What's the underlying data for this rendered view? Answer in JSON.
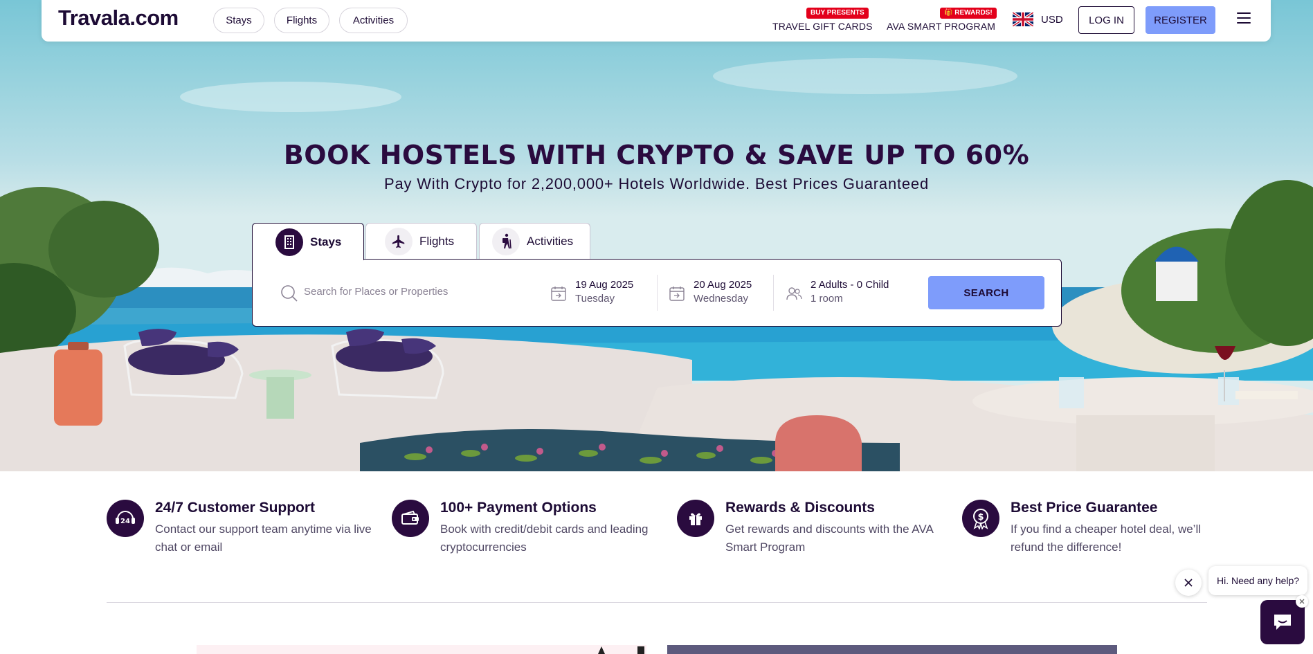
{
  "brand": {
    "logo_text": "Travala.com"
  },
  "nav": {
    "pills": [
      "Stays",
      "Flights",
      "Activities"
    ],
    "gift_cards": {
      "badge": "BUY PRESENTS",
      "label": "TRAVEL GIFT CARDS"
    },
    "ava": {
      "badge": "🎁 REWARDS!",
      "label": "AVA SMART PROGRAM"
    },
    "currency": "USD",
    "login": "LOG IN",
    "register": "REGISTER"
  },
  "hero": {
    "headline": "BOOK HOSTELS WITH CRYPTO & SAVE UP TO 60%",
    "subheadline": "Pay With Crypto for 2,200,000+ Hotels Worldwide. Best Prices Guaranteed"
  },
  "search": {
    "tabs": [
      {
        "label": "Stays",
        "icon": "building-icon",
        "active": true
      },
      {
        "label": "Flights",
        "icon": "plane-icon",
        "active": false
      },
      {
        "label": "Activities",
        "icon": "hiker-icon",
        "active": false
      }
    ],
    "placeholder": "Search for Places or Properties",
    "checkin": {
      "date": "19 Aug 2025",
      "day": "Tuesday"
    },
    "checkout": {
      "date": "20 Aug 2025",
      "day": "Wednesday"
    },
    "guests": {
      "summary": "2 Adults - 0 Child",
      "rooms": "1 room"
    },
    "button": "SEARCH"
  },
  "features": [
    {
      "icon": "support-24-icon",
      "title": "24/7 Customer Support",
      "desc": "Contact our support team anytime via live chat or email"
    },
    {
      "icon": "wallet-icon",
      "title": "100+ Payment Options",
      "desc": "Book with credit/debit cards and leading cryptocurrencies"
    },
    {
      "icon": "gift-icon",
      "title": "Rewards & Discounts",
      "desc": "Get rewards and discounts with the AVA Smart Program"
    },
    {
      "icon": "dollar-badge-icon",
      "title": "Best Price Guarantee",
      "desc": "If you find a cheaper hotel deal, we’ll refund the difference!"
    }
  ],
  "chat": {
    "bubble": "Hi. Need any help?"
  },
  "colors": {
    "brand_dark": "#2a0b3f",
    "accent_blue": "#7e9cfb",
    "badge_red": "#e3001b"
  }
}
